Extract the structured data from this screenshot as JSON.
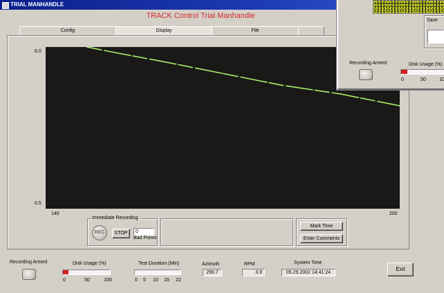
{
  "window": {
    "title": "TRIAL MANHANDLE"
  },
  "app": {
    "heading": "TRACK Control Trial Manhandle"
  },
  "tabs": [
    {
      "label": "Config"
    },
    {
      "label": "Display"
    },
    {
      "label": "File"
    },
    {
      "label": ""
    }
  ],
  "plot": {
    "y_top": "6.0",
    "y_bottom": "0.5",
    "x_left": "140",
    "x_right": "200",
    "line_color": "#a8f06a",
    "background": "#1a1918"
  },
  "chart_data": {
    "type": "line",
    "xlim": [
      140,
      200
    ],
    "ylim": [
      0.5,
      6.0
    ],
    "series": [
      {
        "x": [
          147,
          152,
          160,
          170,
          180,
          190,
          200
        ],
        "y": [
          6.0,
          5.8,
          5.5,
          5.1,
          4.7,
          4.4,
          4.0
        ]
      }
    ]
  },
  "recording": {
    "group_title": "Immediate Recording",
    "rec_label": "REC",
    "stop_label": "STOP",
    "count_value": "0",
    "count_caption": "Bad Points"
  },
  "buttons": {
    "mark_time": "Mark Time",
    "enter_comments": "Enter Comments",
    "exit": "Exit"
  },
  "status": {
    "recording_armed": "Recording Armed",
    "disk_usage": {
      "label": "Disk Usage (%)",
      "ticks": [
        "0",
        "50",
        "100"
      ],
      "value_pct": 12,
      "fill_color": "#d42020"
    },
    "test_duration": {
      "label": "Test Duration (Min)",
      "ticks": [
        "0",
        "5",
        "10",
        "15",
        "22"
      ],
      "value_min": 0
    },
    "azimuth": {
      "label": "Azimuth",
      "value": "290.7"
    },
    "rpm": {
      "label": "RPM",
      "value": "3.9"
    },
    "system_time": {
      "label": "System Time",
      "value": "05.29.2002 14:41:24"
    }
  },
  "overlay_window": {
    "caption": "Save",
    "recording_armed": "Recording Armed",
    "disk_usage_label": "Disk Usage (%)",
    "ticks": [
      "0",
      "50",
      "10"
    ],
    "fill_pct": 15
  }
}
